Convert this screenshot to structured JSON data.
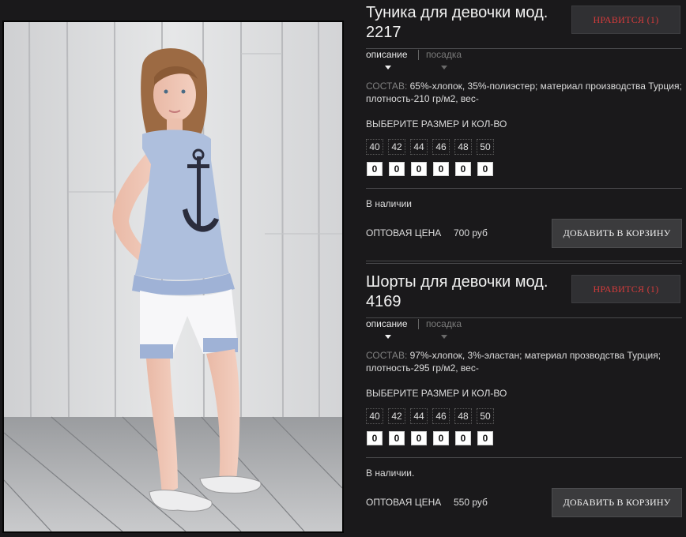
{
  "products": [
    {
      "title": "Туника для девочки мод. 2217",
      "like_label": "НРАВИТСЯ (1)",
      "tabs": {
        "active": "описание",
        "inactive": "посадка"
      },
      "composition_label": "СОСТАВ:",
      "composition_text": "65%-хлопок, 35%-полиэстер; материал производства Турция; плотность-210 гр/м2, вес-",
      "size_title": "ВЫБЕРИТЕ РАЗМЕР И КОЛ-ВО",
      "sizes": [
        "40",
        "42",
        "44",
        "46",
        "48",
        "50"
      ],
      "quantities": [
        "0",
        "0",
        "0",
        "0",
        "0",
        "0"
      ],
      "stock": "В наличии",
      "price_label": "ОПТОВАЯ ЦЕНА",
      "price": "700 руб",
      "cart_label": "ДОБАВИТЬ В КОРЗИНУ"
    },
    {
      "title": "Шорты для девочки мод. 4169",
      "like_label": "НРАВИТСЯ (1)",
      "tabs": {
        "active": "описание",
        "inactive": "посадка"
      },
      "composition_label": "СОСТАВ:",
      "composition_text": "97%-хлопок, 3%-эластан; материал прозводства Турция; плотность-295 гр/м2, вес-",
      "size_title": "ВЫБЕРИТЕ РАЗМЕР И КОЛ-ВО",
      "sizes": [
        "40",
        "42",
        "44",
        "46",
        "48",
        "50"
      ],
      "quantities": [
        "0",
        "0",
        "0",
        "0",
        "0",
        "0"
      ],
      "stock": "В наличии.",
      "price_label": "ОПТОВАЯ ЦЕНА",
      "price": "550 руб",
      "cart_label": "ДОБАВИТЬ В КОРЗИНУ"
    }
  ],
  "colors": {
    "background": "#1a191b",
    "like_text": "#d43b3b",
    "button_bg": "#3b3b3d"
  }
}
